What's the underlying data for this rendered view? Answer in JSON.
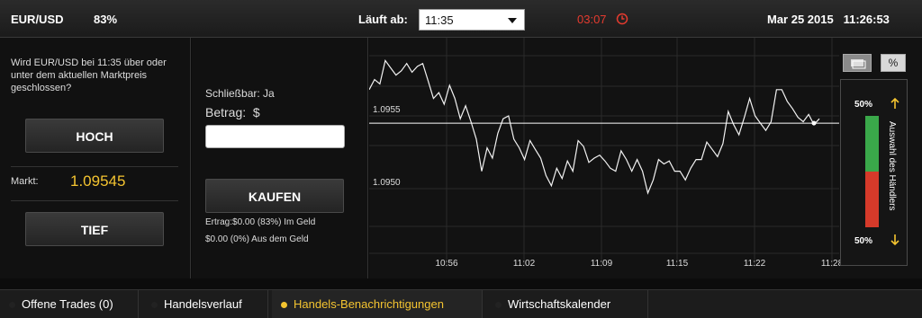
{
  "topbar": {
    "asset": "EUR/USD",
    "payout": "83%",
    "expiry_label": "Läuft ab:",
    "expiry_value": "11:35",
    "countdown": "03:07",
    "date": "Mar 25 2015",
    "time": "11:26:53"
  },
  "left": {
    "question": "Wird EUR/USD bei 11:35 über oder unter dem aktuellen Marktpreis geschlossen?",
    "hoch_label": "HOCH",
    "tief_label": "TIEF",
    "market_label": "Markt:",
    "market_value": "1.09545"
  },
  "mid": {
    "closeable": "Schließbar: Ja",
    "amount_label": "Betrag:",
    "currency": "$",
    "amount_value": "",
    "buy_label": "KAUFEN",
    "profit_in": "Ertrag:$0.00 (83%) Im Geld",
    "profit_out": "$0.00 (0%) Aus dem Geld"
  },
  "chart_data": {
    "type": "line",
    "y_tick_labels": [
      "1.0955",
      "1.0950"
    ],
    "x_tick_labels": [
      "10:56",
      "11:02",
      "11:09",
      "11:15",
      "11:22",
      "11:28"
    ],
    "current_price_line": 1.09545,
    "series": [
      {
        "values": [
          1.09568,
          1.09575,
          1.09572,
          1.09588,
          1.09583,
          1.09578,
          1.09581,
          1.09586,
          1.0958,
          1.09584,
          1.09586,
          1.09574,
          1.09562,
          1.09566,
          1.09558,
          1.09571,
          1.09562,
          1.09548,
          1.09557,
          1.09546,
          1.09534,
          1.09512,
          1.09528,
          1.09521,
          1.09538,
          1.09548,
          1.0955,
          1.09534,
          1.09528,
          1.0952,
          1.09533,
          1.09527,
          1.09521,
          1.09509,
          1.09502,
          1.09514,
          1.09507,
          1.09519,
          1.09512,
          1.09533,
          1.09529,
          1.09518,
          1.09521,
          1.09523,
          1.09519,
          1.09514,
          1.09512,
          1.09526,
          1.0952,
          1.09512,
          1.0952,
          1.09512,
          1.09497,
          1.09506,
          1.0952,
          1.09517,
          1.09519,
          1.09512,
          1.09512,
          1.09506,
          1.09514,
          1.0952,
          1.0952,
          1.09532,
          1.09527,
          1.09522,
          1.09531,
          1.09553,
          1.09544,
          1.09537,
          1.09549,
          1.09562,
          1.0955,
          1.09545,
          1.0954,
          1.09546,
          1.09568,
          1.09568,
          1.0956,
          1.09555,
          1.09549,
          1.09546,
          1.09551,
          1.09544,
          1.09548
        ]
      }
    ]
  },
  "sentiment": {
    "up_percent": "50%",
    "down_percent": "50%",
    "label": "Auswahl des Händlers",
    "up_color": "#3aa84a",
    "down_color": "#d63a2a"
  },
  "tabs": [
    {
      "label": "Offene Trades (0)"
    },
    {
      "label": "Handelsverlauf"
    },
    {
      "label": "Handels-Benachrichtigungen"
    },
    {
      "label": "Wirtschaftskalender"
    }
  ]
}
